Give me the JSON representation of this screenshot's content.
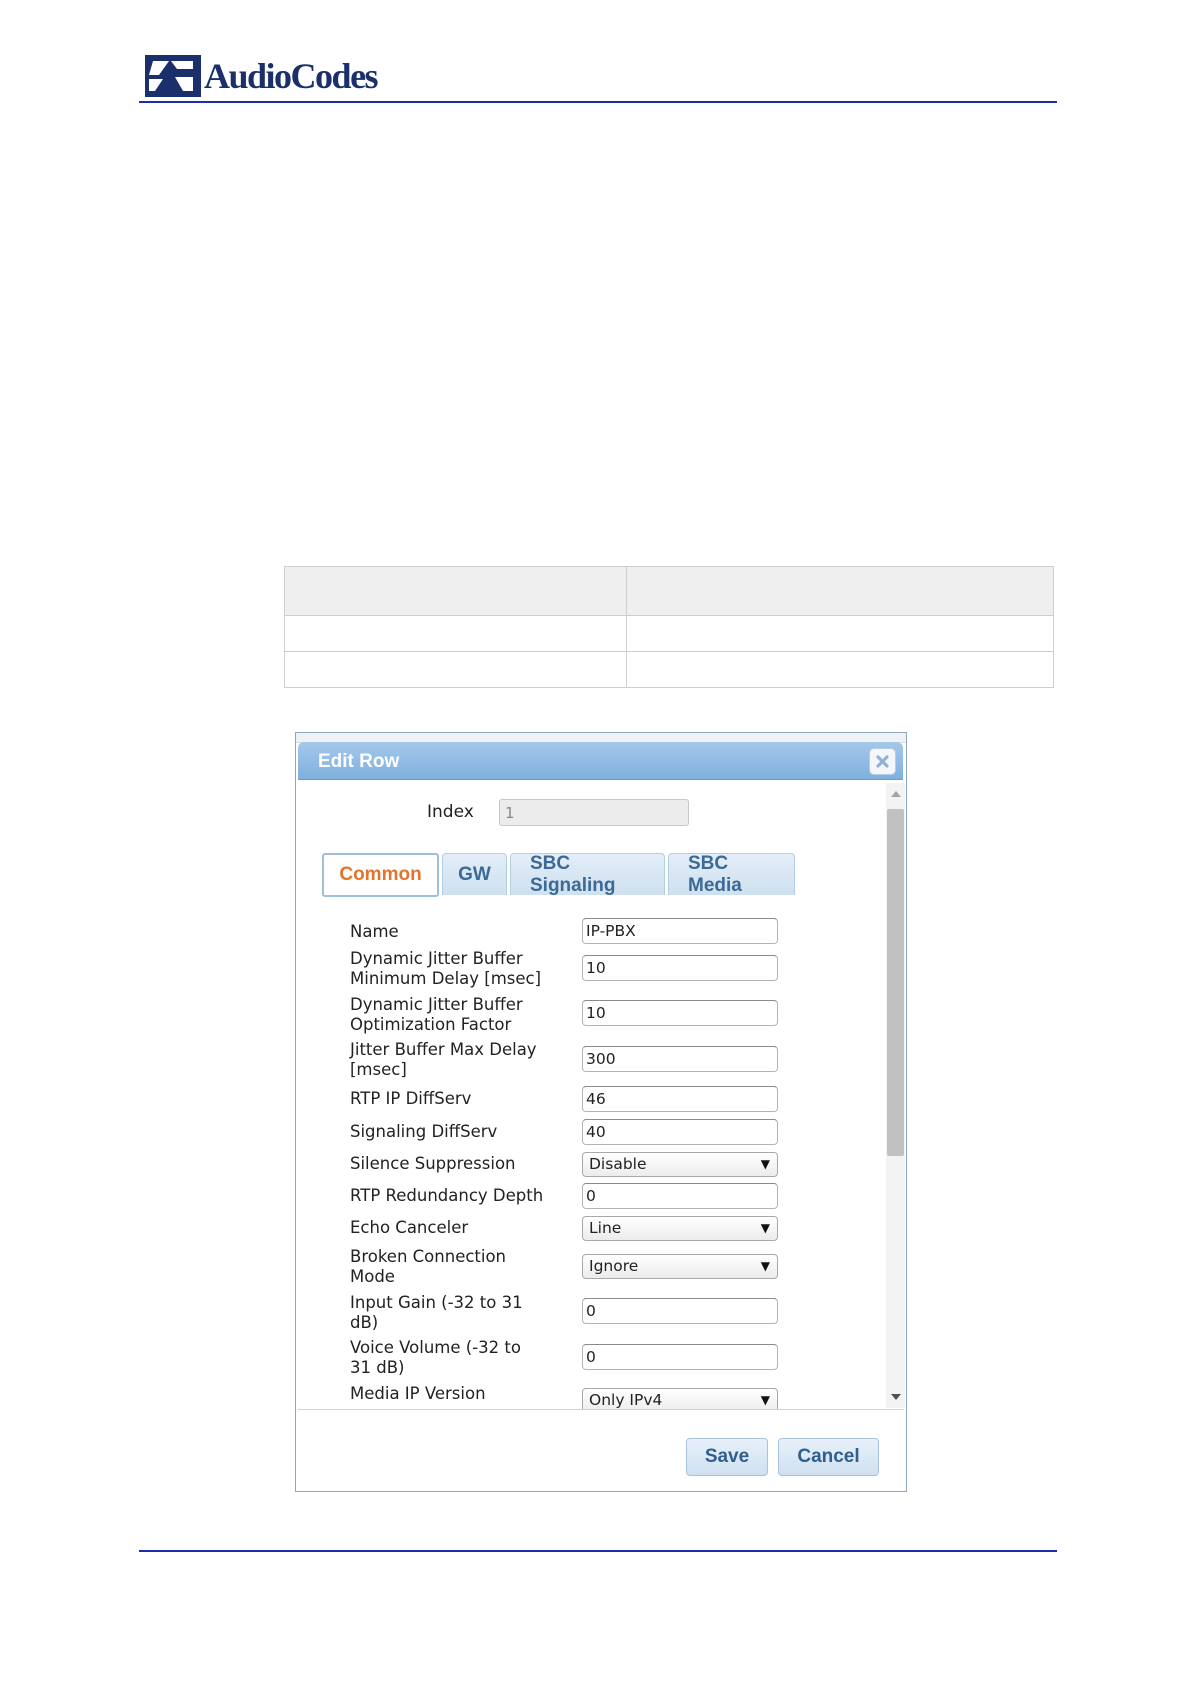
{
  "header": {
    "logo_text": "AudioCodes"
  },
  "dialog": {
    "title": "Edit Row",
    "index": {
      "label": "Index",
      "value": "1"
    },
    "tabs": [
      {
        "label": "Common",
        "active": true
      },
      {
        "label": "GW",
        "active": false
      },
      {
        "label": "SBC Signaling",
        "active": false
      },
      {
        "label": "SBC Media",
        "active": false
      }
    ],
    "fields": [
      {
        "label": "Name",
        "value": "IP-PBX",
        "type": "input"
      },
      {
        "label": "Dynamic Jitter Buffer\nMinimum Delay [msec]",
        "value": "10",
        "type": "input"
      },
      {
        "label": "Dynamic Jitter Buffer\nOptimization Factor",
        "value": "10",
        "type": "input"
      },
      {
        "label": "Jitter Buffer Max Delay\n[msec]",
        "value": "300",
        "type": "input"
      },
      {
        "label": "RTP IP DiffServ",
        "value": "46",
        "type": "input"
      },
      {
        "label": "Signaling DiffServ",
        "value": "40",
        "type": "input"
      },
      {
        "label": "Silence Suppression",
        "value": "Disable",
        "type": "select"
      },
      {
        "label": "RTP Redundancy Depth",
        "value": "0",
        "type": "input"
      },
      {
        "label": "Echo Canceler",
        "value": "Line",
        "type": "select"
      },
      {
        "label": "Broken Connection\nMode",
        "value": "Ignore",
        "type": "select"
      },
      {
        "label": "Input Gain (-32 to 31\ndB)",
        "value": "0",
        "type": "input"
      },
      {
        "label": "Voice Volume (-32 to\n31 dB)",
        "value": "0",
        "type": "input"
      },
      {
        "label": "Media IP Version",
        "value": "Only IPv4",
        "type": "select"
      }
    ],
    "buttons": {
      "save": "Save",
      "cancel": "Cancel"
    }
  },
  "colors": {
    "rule": "#1f2dab",
    "titlebar": "#8dbbe6",
    "active_tab_text": "#e2742d",
    "tab_text": "#3b6a97"
  }
}
